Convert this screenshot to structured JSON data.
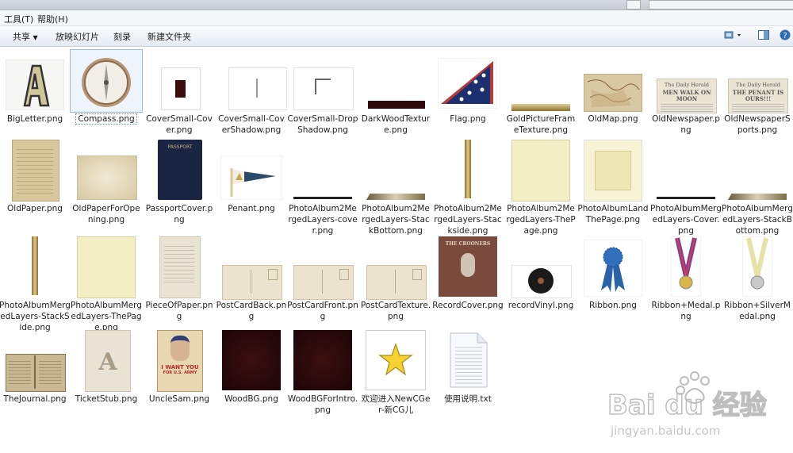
{
  "menu": {
    "tools": "工具(T)",
    "help": "帮助(H)"
  },
  "toolbar": {
    "share": "共享",
    "slideshow": "放映幻灯片",
    "burn": "刻录",
    "new_folder": "新建文件夹"
  },
  "files": [
    {
      "name": "BigLetter.png",
      "icon": "big-letter-a-icon"
    },
    {
      "name": "Compass.png",
      "icon": "compass-icon",
      "selected": true
    },
    {
      "name": "CoverSmall-Cover.png",
      "icon": "cover-small-icon"
    },
    {
      "name": "CoverSmall-CoverShadow.png",
      "icon": "cover-shadow-icon"
    },
    {
      "name": "CoverSmall-DropShadow.png",
      "icon": "drop-shadow-icon"
    },
    {
      "name": "DarkWoodTexture.png",
      "icon": "dark-wood-strip-icon"
    },
    {
      "name": "Flag.png",
      "icon": "flag-icon"
    },
    {
      "name": "GoldPictureFrameTexture.png",
      "icon": "gold-strip-icon"
    },
    {
      "name": "OldMap.png",
      "icon": "old-map-icon"
    },
    {
      "name": "OldNewspaper.png",
      "icon": "newspaper-icon"
    },
    {
      "name": "OldNewspaperSports.png",
      "icon": "newspaper-sports-icon"
    },
    {
      "name": "OldPaper.png",
      "icon": "old-paper-icon"
    },
    {
      "name": "OldPaperForOpening.png",
      "icon": "paper-opening-icon"
    },
    {
      "name": "PassportCover.png",
      "icon": "passport-icon"
    },
    {
      "name": "Penant.png",
      "icon": "pennant-icon"
    },
    {
      "name": "PhotoAlbum2MergedLayers-cover.png",
      "icon": "thin-line-icon"
    },
    {
      "name": "PhotoAlbum2MergedLayers-StackBottom.png",
      "icon": "stack-bottom-icon"
    },
    {
      "name": "PhotoAlbum2MergedLayers-Stackside.png",
      "icon": "gold-vertical-icon"
    },
    {
      "name": "PhotoAlbum2MergedLayers-ThePage.png",
      "icon": "cream-page-icon"
    },
    {
      "name": "PhotoAlbumLandThePage.png",
      "icon": "cream-page-framed-icon"
    },
    {
      "name": "PhotoAlbumMergedLayers-Cover.png",
      "icon": "thin-line-icon"
    },
    {
      "name": "PhotoAlbumMergedLayers-StackBottom.png",
      "icon": "stack-bottom-icon"
    },
    {
      "name": "PhotoAlbumMergedLayers-StackSide.png",
      "icon": "gold-vertical-icon"
    },
    {
      "name": "PhotoAlbumMergedLayers-ThePage.png",
      "icon": "cream-page-icon"
    },
    {
      "name": "PieceOfPaper.png",
      "icon": "piece-of-paper-icon"
    },
    {
      "name": "PostCardBack.png",
      "icon": "postcard-icon"
    },
    {
      "name": "PostCardFront.png",
      "icon": "postcard-icon"
    },
    {
      "name": "PostCardTexture.png",
      "icon": "postcard-icon"
    },
    {
      "name": "RecordCover.png",
      "icon": "record-cover-icon"
    },
    {
      "name": "recordVinyl.png",
      "icon": "vinyl-icon"
    },
    {
      "name": "Ribbon.png",
      "icon": "ribbon-icon"
    },
    {
      "name": "Ribbon+Medal.png",
      "icon": "gold-medal-icon"
    },
    {
      "name": "Ribbon+SilverMedal.png",
      "icon": "silver-medal-icon"
    },
    {
      "name": "TheJournal.png",
      "icon": "journal-icon"
    },
    {
      "name": "TicketStub.png",
      "icon": "ticket-stub-icon"
    },
    {
      "name": "UncleSam.png",
      "icon": "uncle-sam-icon"
    },
    {
      "name": "WoodBG.png",
      "icon": "wood-bg-icon"
    },
    {
      "name": "WoodBGForIntro.png",
      "icon": "wood-bg-icon"
    },
    {
      "name": "欢迎进入NewCGer-新CG儿",
      "icon": "star-shortcut-icon"
    },
    {
      "name": "使用说明.txt",
      "icon": "text-file-icon"
    }
  ],
  "thumb_text": {
    "newspaper_title": "The Daily Herald",
    "newspaper_headline": "MEN WALK ON MOON",
    "sports_headline": "THE PENANT IS OURS!!!",
    "passport": "PASSPORT",
    "record_title": "THE CROONERS",
    "uncle_sam_main": "I WANT YOU",
    "uncle_sam_sub": "FOR U.S. ARMY",
    "big_letter": "A"
  },
  "watermark": {
    "brand": "Bai du 经验",
    "url": "jingyan.baidu.com"
  }
}
